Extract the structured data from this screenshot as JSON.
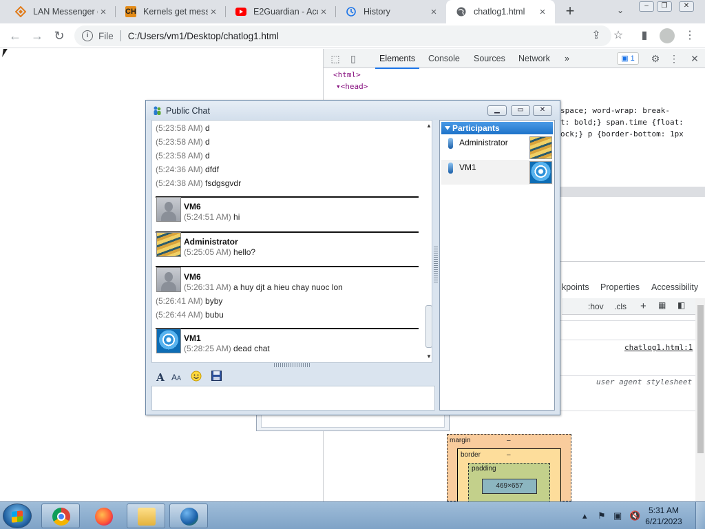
{
  "browser": {
    "tabs": [
      {
        "label": "LAN Messenger d",
        "icon": "lan-messenger-icon"
      },
      {
        "label": "Kernels get messy",
        "icon": "ch-icon"
      },
      {
        "label": "E2Guardian - Acc",
        "icon": "youtube-icon"
      },
      {
        "label": "History",
        "icon": "history-icon"
      },
      {
        "label": "chatlog1.html",
        "icon": "globe-icon"
      }
    ],
    "address": {
      "scheme_label": "File",
      "url": "C:/Users/vm1/Desktop/chatlog1.html"
    },
    "window_buttons": [
      "–",
      "❐",
      "✕"
    ]
  },
  "devtools": {
    "tabs": [
      "Elements",
      "Console",
      "Sources",
      "Network"
    ],
    "more": "»",
    "issues_count": "1",
    "code_lines": [
      "<html>",
      "<head>"
    ],
    "css_fragments": [
      "space; word-wrap: break-",
      "t: bold;} span.time {float:",
      "ock;} p {border-bottom: 1px"
    ],
    "sub_tabs": [
      "kpoints",
      "Properties",
      "Accessibility"
    ],
    "styles_filter": {
      "hov": ":hov",
      "cls": ".cls"
    },
    "rule_link": "chatlog1.html:1",
    "user_agent": "user agent stylesheet",
    "box_model": {
      "margin": "margin",
      "border": "border",
      "padding": "padding",
      "content": "469×657",
      "dash": "–"
    }
  },
  "chat": {
    "title": "Public Chat",
    "lines_top": [
      {
        "time": "(5:23:58 AM)",
        "text": "d"
      },
      {
        "time": "(5:23:58 AM)",
        "text": "d"
      },
      {
        "time": "(5:23:58 AM)",
        "text": "d"
      },
      {
        "time": "(5:24:36 AM)",
        "text": "dfdf"
      },
      {
        "time": "(5:24:38 AM)",
        "text": "fsdgsgvdr"
      }
    ],
    "blocks": [
      {
        "sender": "VM6",
        "messages": [
          {
            "time": "(5:24:51 AM)",
            "text": "hi"
          }
        ]
      },
      {
        "sender": "Administrator",
        "messages": [
          {
            "time": "(5:25:05 AM)",
            "text": "hello?"
          }
        ]
      },
      {
        "sender": "VM6",
        "messages": [
          {
            "time": "(5:26:31 AM)",
            "text": "a huy djt a hieu chay nuoc lon"
          },
          {
            "time": "(5:26:41 AM)",
            "text": "byby"
          },
          {
            "time": "(5:26:44 AM)",
            "text": "bubu"
          }
        ]
      },
      {
        "sender": "VM1",
        "messages": [
          {
            "time": "(5:28:25 AM)",
            "text": "dead chat"
          }
        ]
      }
    ],
    "participants_header": "Participants",
    "participants": [
      {
        "name": "Administrator",
        "avatar": "stairs"
      },
      {
        "name": "VM1",
        "avatar": "wheel"
      }
    ],
    "format_tools": [
      "font-icon",
      "font-color-icon",
      "smiley-icon",
      "save-icon"
    ]
  },
  "taskbar": {
    "apps": [
      "chrome-icon",
      "firefox-icon",
      "explorer-icon",
      "lan-messenger-icon"
    ],
    "clock_time": "5:31 AM",
    "clock_date": "6/21/2023"
  }
}
